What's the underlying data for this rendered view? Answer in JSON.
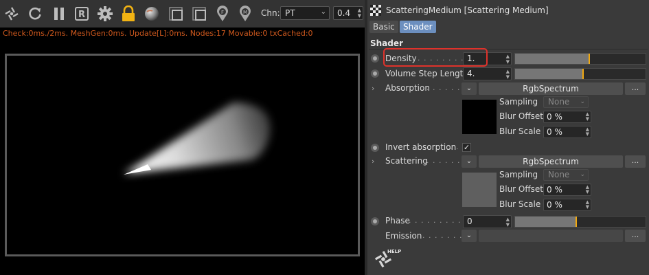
{
  "toolbar": {
    "icons": [
      "octane-logo-icon",
      "refresh-icon",
      "pause-icon",
      "r-badge-icon",
      "gear-icon",
      "lock-icon",
      "sphere-icon",
      "region-icon",
      "region-alt-icon",
      "pin-f-icon",
      "pin-m-icon"
    ],
    "channel_label": "Chn:",
    "channel_value": "PT",
    "zoom_value": "0.4"
  },
  "status": {
    "text": "Check:0ms./2ms. MeshGen:0ms. Update[L]:0ms. Nodes:17 Movable:0 txCached:0",
    "color": "#d25a1e"
  },
  "panel": {
    "title": "ScatteringMedium [Scattering Medium]",
    "tabs": [
      "Basic",
      "Shader"
    ],
    "section_title": "Shader",
    "density": {
      "label": "Density",
      "value": "1.",
      "slider_fraction": 0.57
    },
    "volume_step": {
      "label": "Volume Step Length",
      "value": "4.",
      "slider_fraction": 0.52
    },
    "absorption": {
      "label": "Absorption",
      "button": "RgbSpectrum",
      "more": "...",
      "swatch_color": "#000000",
      "sampling_label": "Sampling",
      "sampling_value": "None",
      "blur_offset_label": "Blur Offset",
      "blur_offset_value": "0 %",
      "blur_scale_label": "Blur Scale",
      "blur_scale_value": "0 %"
    },
    "invert_absorption": {
      "label": "Invert absorption",
      "checked": "✓"
    },
    "scattering": {
      "label": "Scattering",
      "button": "RgbSpectrum",
      "more": "...",
      "swatch_color": "#5f5f5f",
      "sampling_label": "Sampling",
      "sampling_value": "None",
      "blur_offset_label": "Blur Offset",
      "blur_offset_value": "0 %",
      "blur_scale_label": "Blur Scale",
      "blur_scale_value": "0 %"
    },
    "phase": {
      "label": "Phase",
      "value": "0",
      "slider_fraction": 0.47
    },
    "emission": {
      "label": "Emission",
      "more": "..."
    },
    "help_label": "HELP"
  },
  "colors": {
    "accent": "#6c8fbf",
    "slider_handle": "#f2a90f",
    "highlight": "#e0322b"
  }
}
